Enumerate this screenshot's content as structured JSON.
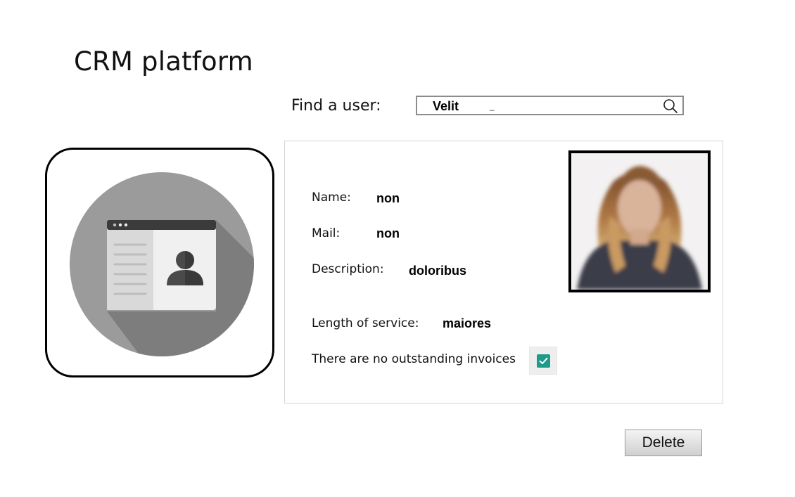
{
  "app": {
    "title": "CRM platform"
  },
  "search": {
    "label": "Find a user:",
    "value": "Velit",
    "cursor": "_",
    "icon": "search-icon"
  },
  "profile_icon": {
    "icon": "contact-card-icon"
  },
  "user": {
    "name_label": "Name:",
    "name_value": "non",
    "mail_label": "Mail:",
    "mail_value": "non",
    "description_label": "Description:",
    "description_value": "doloribus",
    "service_label": "Length of service:",
    "service_value": "maiores",
    "invoices_label": "There are no outstanding invoices",
    "invoices_checked": true
  },
  "actions": {
    "delete_label": "Delete"
  },
  "colors": {
    "checkbox": "#1e9b8a",
    "icon_circle": "#9b9b9b",
    "icon_shadow": "#7a7a7a"
  }
}
